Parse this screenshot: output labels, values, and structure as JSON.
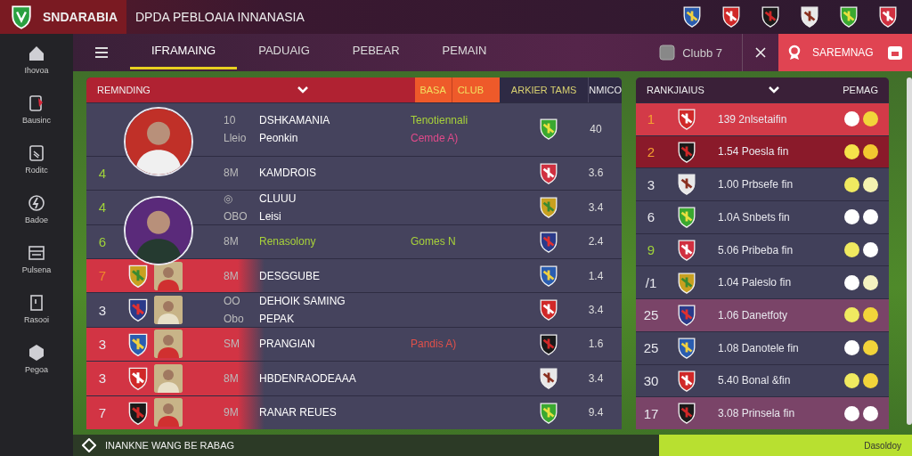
{
  "header": {
    "brand": "SNDARABIA",
    "title": "DPDA PEBLOAIA INNANASIA"
  },
  "sidebar": {
    "items": [
      {
        "label": "Ihovoa"
      },
      {
        "label": "Bausinc"
      },
      {
        "label": "Roditc"
      },
      {
        "label": "Badoe"
      },
      {
        "label": "Pulsena"
      },
      {
        "label": "Rasooi"
      },
      {
        "label": "Pegoa"
      }
    ]
  },
  "nav": {
    "tabs": [
      {
        "label": "IFRAMAING",
        "selected": true
      },
      {
        "label": "PADUAIG",
        "selected": false
      },
      {
        "label": "PEBEAR",
        "selected": false
      },
      {
        "label": "PEMAIN",
        "selected": false
      }
    ],
    "club_filter": "Clubb 7",
    "action_button": "SAREMNAG"
  },
  "table": {
    "header": {
      "title": "REMNDING",
      "column_1": "BASA",
      "column_2": "CLUB",
      "column_3": "ARKIER TAMS",
      "column_4": "NMICO"
    },
    "rows": [
      {
        "kind": "avatar",
        "highlight": false,
        "code": "10",
        "name": "DSHKAMANIA",
        "sub_code": "Lleio",
        "sub_name": "Peonkin",
        "notes": [
          {
            "text": "Tenotiennali",
            "color": "#a8d23a"
          },
          {
            "text": "Cemde A)",
            "color": "#e04a8a"
          }
        ],
        "value": "40"
      },
      {
        "rank": "4",
        "color": "#9fd23a",
        "kind": "plain",
        "highlight": false,
        "code": "8M",
        "name": "KAMDROIS",
        "value": "3.6"
      },
      {
        "rank": "4",
        "color": "#9fd23a",
        "kind": "avatar",
        "highlight": false,
        "code": "◎",
        "name": "CLUUU",
        "sub_code": "OBO",
        "sub_name": "Leisi",
        "value": "3.4"
      },
      {
        "rank": "6",
        "color": "#9fd23a",
        "kind": "plain",
        "highlight": false,
        "accent": true,
        "code": "8M",
        "name": "Renasolony",
        "notes": [
          {
            "text": "Gomes N",
            "color": "#a8d23a"
          }
        ],
        "value": "2.4"
      },
      {
        "rank": "7",
        "color": "#f08a2a",
        "kind": "crest",
        "highlight": true,
        "code": "8M",
        "name": "DESGGUBE",
        "value": "1.4"
      },
      {
        "rank": "3",
        "color": "#e8e8ee",
        "kind": "crest",
        "highlight": false,
        "code": "OO",
        "name": "DEHOIK SAMING",
        "sub_code": "Obo",
        "sub_name": "PEPAK",
        "value": "3.4"
      },
      {
        "rank": "3",
        "color": "#e8e8ee",
        "kind": "crest",
        "highlight": true,
        "code": "SM",
        "name": "PRANGIAN",
        "notes": [
          {
            "text": "Pandis A)",
            "color": "#e0504a"
          }
        ],
        "value": "1.6"
      },
      {
        "rank": "3",
        "color": "#e8e8ee",
        "kind": "crest",
        "highlight": true,
        "code": "8M",
        "name": "HBDENRAODEAAA",
        "value": "3.4"
      },
      {
        "rank": "7",
        "color": "#e8e8ee",
        "kind": "crest",
        "highlight": true,
        "code": "9M",
        "name": "RANAR REUES",
        "value": "9.4"
      }
    ]
  },
  "rankings": {
    "title": "RANKJIAIUS",
    "column": "PEMAG",
    "rows": [
      {
        "rank": "1",
        "color": "#f5a030",
        "kind": "red",
        "text": "139 2nlsetaifin",
        "dots": [
          {
            "color": "#ffffff"
          },
          {
            "color": "#f2d43a"
          }
        ]
      },
      {
        "rank": "2",
        "color": "#f5a030",
        "kind": "maroon",
        "text": "1.54 Poesla fin",
        "dots": [
          {
            "color": "#f5e34a"
          },
          {
            "color": "#f2c830"
          }
        ]
      },
      {
        "rank": "3",
        "color": "#e8e8ee",
        "kind": "plain",
        "text": "1.00 Prbsefe fin",
        "dots": [
          {
            "color": "#f0ea60"
          },
          {
            "color": "#f4f2b0"
          }
        ]
      },
      {
        "rank": "6",
        "color": "#e8e8ee",
        "kind": "plain",
        "text": "1.0A Snbets fin",
        "dots": [
          {
            "color": "#ffffff"
          },
          {
            "color": "#ffffff"
          }
        ]
      },
      {
        "rank": "9",
        "color": "#9fd23a",
        "kind": "plain",
        "text": "5.06 Pribeba fin",
        "dots": [
          {
            "color": "#f0ea60"
          },
          {
            "color": "#ffffff"
          }
        ]
      },
      {
        "rank": "/1",
        "color": "#e8e8ee",
        "kind": "plain",
        "text": "1.04 Paleslo fin",
        "dots": [
          {
            "color": "#ffffff"
          },
          {
            "color": "#f4f2c0"
          }
        ]
      },
      {
        "rank": "25",
        "color": "#e8e8ee",
        "kind": "plum",
        "text": "1.06 Danetfoty",
        "dots": [
          {
            "color": "#f0ea60"
          },
          {
            "color": "#f2d43a"
          }
        ]
      },
      {
        "rank": "25",
        "color": "#e8e8ee",
        "kind": "plain",
        "text": "1.08 Danotele fin",
        "dots": [
          {
            "color": "#ffffff"
          },
          {
            "color": "#f2d43a"
          }
        ]
      },
      {
        "rank": "30",
        "color": "#e8e8ee",
        "kind": "plain",
        "text": "5.40 Bonal &fin",
        "dots": [
          {
            "color": "#f0ea60"
          },
          {
            "color": "#f2d43a"
          }
        ]
      },
      {
        "rank": "17",
        "color": "#e8e8ee",
        "kind": "plum",
        "text": "3.08 Prinsela fin",
        "dots": [
          {
            "color": "#ffffff"
          },
          {
            "color": "#ffffff"
          }
        ]
      }
    ]
  },
  "footer": {
    "text": "INANKNE WANG BE RABAG",
    "action": "Dasoldoy"
  }
}
